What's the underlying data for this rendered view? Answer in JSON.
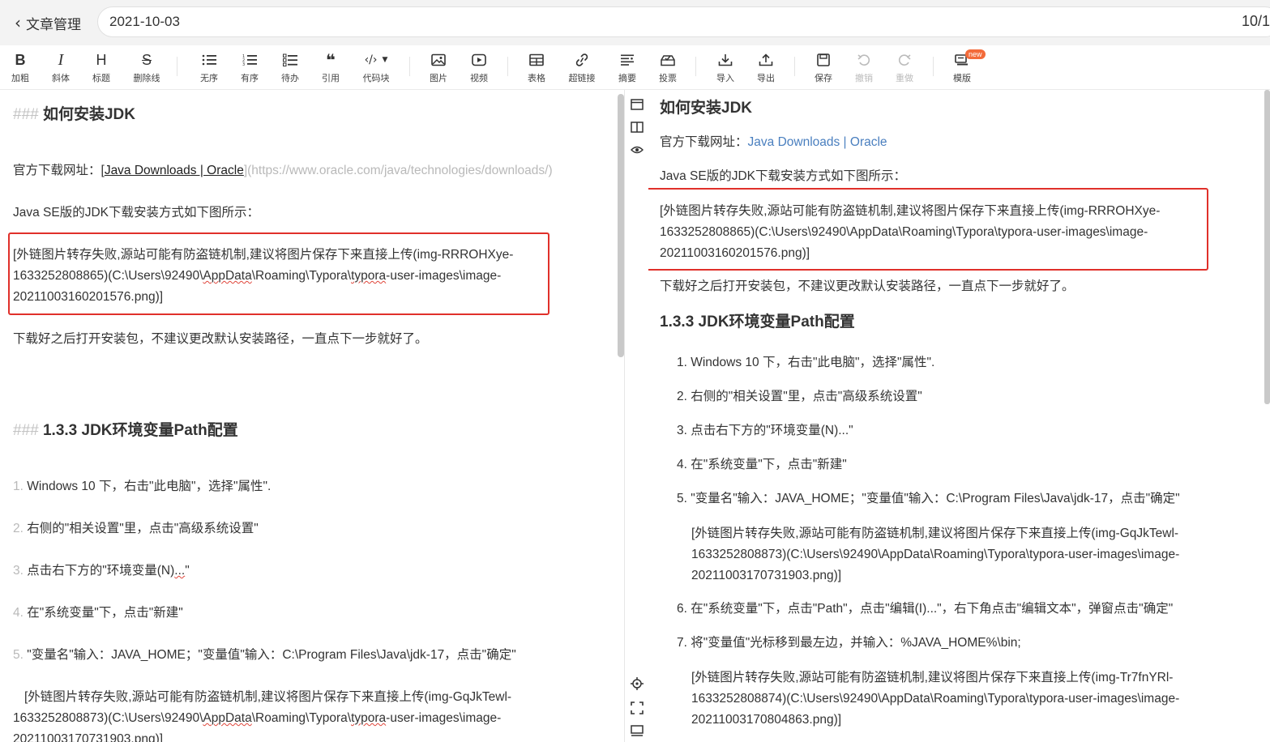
{
  "header": {
    "back_label": "文章管理",
    "title_value": "2021-10-03",
    "counter": "10/1"
  },
  "toolbar": {
    "items": [
      {
        "label": "加粗",
        "icon": "bold-icon",
        "glyph": "B"
      },
      {
        "label": "斜体",
        "icon": "italic-icon",
        "glyph": "I"
      },
      {
        "label": "标题",
        "icon": "heading-icon",
        "glyph": "H"
      },
      {
        "label": "删除线",
        "icon": "strikethrough-icon",
        "glyph": "S"
      },
      {
        "label": "无序",
        "icon": "unordered-list-icon"
      },
      {
        "label": "有序",
        "icon": "ordered-list-icon"
      },
      {
        "label": "待办",
        "icon": "todo-list-icon"
      },
      {
        "label": "引用",
        "icon": "quote-icon",
        "glyph": "❝"
      },
      {
        "label": "代码块",
        "icon": "code-block-icon",
        "glyph": "‹/›"
      },
      {
        "label": "图片",
        "icon": "image-icon"
      },
      {
        "label": "视频",
        "icon": "video-icon"
      },
      {
        "label": "表格",
        "icon": "table-icon"
      },
      {
        "label": "超链接",
        "icon": "link-icon"
      },
      {
        "label": "摘要",
        "icon": "summary-icon"
      },
      {
        "label": "投票",
        "icon": "vote-icon"
      },
      {
        "label": "导入",
        "icon": "import-icon"
      },
      {
        "label": "导出",
        "icon": "export-icon"
      },
      {
        "label": "保存",
        "icon": "save-icon"
      },
      {
        "label": "撤销",
        "icon": "undo-icon"
      },
      {
        "label": "重做",
        "icon": "redo-icon"
      },
      {
        "label": "模版",
        "icon": "template-icon"
      }
    ],
    "new_badge": "new"
  },
  "editor": {
    "heading1_marker": "###",
    "heading1_text": "如何安装JDK",
    "download_prefix": "官方下载网址：[",
    "download_link_text": "Java Downloads | Oracle",
    "download_url_part": "](https://www.oracle.com/java/technologies/downloads/)",
    "javase_line": "Java SE版的JDK下载安装方式如下图所示：",
    "img1_line1": "[外链图片转存失败,源站可能有防盗链机制,建议将图片保存下来直接上传(img-RRROHXye-",
    "img1_line2_a": "1633252808865)(C:\\Users\\92490\\",
    "img1_line2_b": "AppData",
    "img1_line2_c": "\\Roaming\\Typora\\",
    "img1_line2_d": "typora",
    "img1_line2_e": "-user-images\\image-",
    "img1_line3": "20211003160201576.png)]",
    "after_download": "下载好之后打开安装包，不建议更改默认安装路径，一直点下一步就好了。",
    "heading2_marker": "###",
    "heading2_text": "1.3.3 JDK环境变量Path配置",
    "list": [
      {
        "num": "1.",
        "text": "Windows 10 下，右击\"此电脑\"，选择\"属性\"."
      },
      {
        "num": "2.",
        "text": "右侧的\"相关设置\"里，点击\"高级系统设置\""
      },
      {
        "num": "3.",
        "text_a": "点击右下方的\"环境变量(N)",
        "text_b": "...",
        "text_c": "\""
      },
      {
        "num": "4.",
        "text": "在\"系统变量\"下，点击\"新建\""
      },
      {
        "num": "5.",
        "text": "\"变量名\"输入：JAVA_HOME；\"变量值\"输入：C:\\Program Files\\Java\\jdk-17，点击\"确定\""
      }
    ],
    "img2_line1": "[外链图片转存失败,源站可能有防盗链机制,建议将图片保存下来直接上传(img-GqJkTewl-",
    "img2_line2_a": "1633252808873)(C:\\Users\\92490\\",
    "img2_line2_b": "AppData",
    "img2_line2_c": "\\Roaming\\Typora\\",
    "img2_line2_d": "typora",
    "img2_line2_e": "-user-images\\image-",
    "img2_line3": "20211003170731903.png)]"
  },
  "midtools": [
    "editor-only-icon",
    "split-view-icon",
    "preview-eye-icon",
    "locate-icon",
    "fullscreen-icon",
    "toc-icon"
  ],
  "preview": {
    "heading1": "如何安装JDK",
    "download_prefix": "官方下载网址：",
    "download_link": "Java Downloads | Oracle",
    "javase_line": "Java SE版的JDK下载安装方式如下图所示：",
    "img1_line1": "[外链图片转存失败,源站可能有防盗链机制,建议将图片保存下来直接上传(img-RRROHXye-",
    "img1_line2": "1633252808865)(C:\\Users\\92490\\AppData\\Roaming\\Typora\\typora-user-images\\image-",
    "img1_line3": "20211003160201576.png)]",
    "after_download": "下载好之后打开安装包，不建议更改默认安装路径，一直点下一步就好了。",
    "heading2": "1.3.3 JDK环境变量Path配置",
    "list": [
      "1. Windows 10 下，右击\"此电脑\"，选择\"属性\".",
      "2. 右侧的\"相关设置\"里，点击\"高级系统设置\"",
      "3. 点击右下方的\"环境变量(N)...\"",
      "4. 在\"系统变量\"下，点击\"新建\"",
      "5. \"变量名\"输入：JAVA_HOME；\"变量值\"输入：C:\\Program Files\\Java\\jdk-17，点击\"确定\"",
      "6. 在\"系统变量\"下，点击\"Path\"，点击\"编辑(I)...\"，右下角点击\"编辑文本\"，弹窗点击\"确定\"",
      "7. 将\"变量值\"光标移到最左边，并输入：%JAVA_HOME%\\bin;"
    ],
    "img2_line1": "[外链图片转存失败,源站可能有防盗链机制,建议将图片保存下来直接上传(img-GqJkTewl-",
    "img2_line2": "1633252808873)(C:\\Users\\92490\\AppData\\Roaming\\Typora\\typora-user-images\\image-",
    "img2_line3": "20211003170731903.png)]",
    "img3_line1": "[外链图片转存失败,源站可能有防盗链机制,建议将图片保存下来直接上传(img-Tr7fnYRl-",
    "img3_line2": "1633252808874)(C:\\Users\\92490\\AppData\\Roaming\\Typora\\typora-user-images\\image-",
    "img3_line3": "20211003170804863.png)]"
  },
  "colors": {
    "highlight_box": "#e0302a",
    "link": "#4a7fbf",
    "badge": "#f36b3a"
  }
}
